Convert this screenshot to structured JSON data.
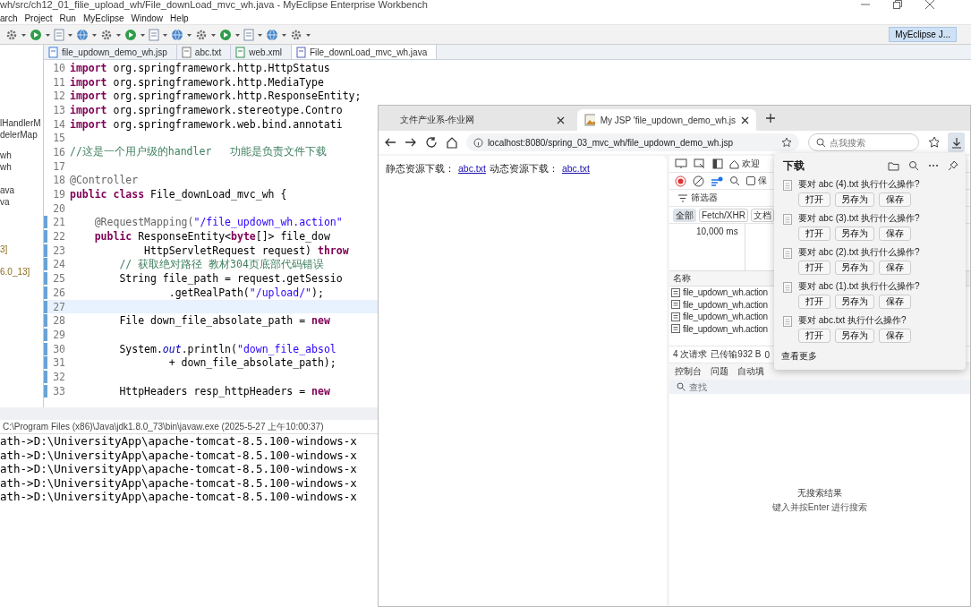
{
  "ide": {
    "title": "wh/src/ch12_01_filie_upload_wh/File_downLoad_mvc_wh.java - MyEclipse Enterprise Workbench",
    "menus": [
      "arch",
      "Project",
      "Run",
      "MyEclipse",
      "Window",
      "Help"
    ],
    "perspective": "MyEclipse J...",
    "editor_tabs": [
      {
        "label": "file_updown_demo_wh.jsp",
        "kind": "jsp",
        "selected": false
      },
      {
        "label": "abc.txt",
        "kind": "txt",
        "selected": false
      },
      {
        "label": "web.xml",
        "kind": "xml",
        "selected": false
      },
      {
        "label": "File_downLoad_mvc_wh.java",
        "kind": "java",
        "selected": true
      }
    ],
    "explorer": [
      "lHandlerM",
      "delerMap",
      "wh",
      "wh",
      "ava",
      "va",
      "3]",
      "6.0_13]"
    ],
    "code_lines": [
      {
        "number": "10",
        "current": false,
        "segments": [
          {
            "kind": "keyword",
            "text": "import"
          },
          {
            "kind": "plain",
            "text": " org.springframework.http.HttpStatus"
          }
        ]
      },
      {
        "number": "11",
        "current": false,
        "segments": [
          {
            "kind": "keyword",
            "text": "import"
          },
          {
            "kind": "plain",
            "text": " org.springframework.http.MediaType"
          }
        ]
      },
      {
        "number": "12",
        "current": false,
        "segments": [
          {
            "kind": "keyword",
            "text": "import"
          },
          {
            "kind": "plain",
            "text": " org.springframework.http.ResponseEntity;"
          }
        ]
      },
      {
        "number": "13",
        "current": false,
        "segments": [
          {
            "kind": "keyword",
            "text": "import"
          },
          {
            "kind": "plain",
            "text": " org.springframework.stereotype.Contro"
          }
        ]
      },
      {
        "number": "14",
        "current": false,
        "segments": [
          {
            "kind": "keyword",
            "text": "import"
          },
          {
            "kind": "plain",
            "text": " org.springframework.web.bind.annotati"
          }
        ]
      },
      {
        "number": "15",
        "current": false
      },
      {
        "number": "16",
        "current": false,
        "segments": [
          {
            "kind": "comment",
            "text": "//这是一个用户级的handler   功能是负责文件下载"
          }
        ]
      },
      {
        "number": "17",
        "current": false
      },
      {
        "number": "18",
        "current": false,
        "segments": [
          {
            "kind": "annotation",
            "text": "@Controller"
          }
        ]
      },
      {
        "number": "19",
        "current": false,
        "segments": [
          {
            "kind": "keyword",
            "text": "public class"
          },
          {
            "kind": "plain",
            "text": " File_downLoad_mvc_wh {"
          }
        ]
      },
      {
        "number": "20",
        "current": false
      },
      {
        "number": "21",
        "current": false,
        "segments": [
          {
            "kind": "annotation",
            "text": "    @RequestMapping("
          },
          {
            "kind": "string",
            "text": "\"/file_updown_wh.action\""
          }
        ]
      },
      {
        "number": "22",
        "current": false,
        "segments": [
          {
            "kind": "keyword",
            "text": "    public"
          },
          {
            "kind": "plain",
            "text": " ResponseEntity<"
          },
          {
            "kind": "keyword",
            "text": "byte"
          },
          {
            "kind": "plain",
            "text": "[]> file_dow"
          }
        ]
      },
      {
        "number": "23",
        "current": false,
        "segments": [
          {
            "kind": "plain",
            "text": "            HttpServletRequest request) "
          },
          {
            "kind": "keyword",
            "text": "throw"
          }
        ]
      },
      {
        "number": "24",
        "current": false,
        "segments": [
          {
            "kind": "comment",
            "text": "        // 获取绝对路径 教材304页底部代码错误"
          }
        ]
      },
      {
        "number": "25",
        "current": false,
        "segments": [
          {
            "kind": "plain",
            "text": "        String file_path = request.getSessio"
          }
        ]
      },
      {
        "number": "26",
        "current": false,
        "segments": [
          {
            "kind": "plain",
            "text": "                .getRealPath("
          },
          {
            "kind": "string",
            "text": "\"/upload/\""
          },
          {
            "kind": "plain",
            "text": ");"
          }
        ]
      },
      {
        "number": "27",
        "current": true
      },
      {
        "number": "28",
        "current": false,
        "segments": [
          {
            "kind": "plain",
            "text": "        File down_file_absolate_path = "
          },
          {
            "kind": "keyword",
            "text": "new"
          }
        ]
      },
      {
        "number": "29",
        "current": false
      },
      {
        "number": "30",
        "current": false,
        "segments": [
          {
            "kind": "plain",
            "text": "        System."
          },
          {
            "kind": "field",
            "text": "out"
          },
          {
            "kind": "plain",
            "text": ".println("
          },
          {
            "kind": "string",
            "text": "\"down_file_absol"
          }
        ]
      },
      {
        "number": "31",
        "current": false,
        "segments": [
          {
            "kind": "plain",
            "text": "                + down_file_absolate_path);"
          }
        ]
      },
      {
        "number": "32",
        "current": false
      },
      {
        "number": "33",
        "current": false,
        "segments": [
          {
            "kind": "plain",
            "text": "        HttpHeaders resp_httpHeaders = "
          },
          {
            "kind": "keyword",
            "text": "new"
          }
        ]
      }
    ],
    "console": {
      "header": "C:\\Program Files (x86)\\Java\\jdk1.8.0_73\\bin\\javaw.exe (2025-5-27 上午10:00:37)",
      "lines": [
        "ath->D:\\UniversityApp\\apache-tomcat-8.5.100-windows-x",
        "ath->D:\\UniversityApp\\apache-tomcat-8.5.100-windows-x",
        "ath->D:\\UniversityApp\\apache-tomcat-8.5.100-windows-x",
        "ath->D:\\UniversityApp\\apache-tomcat-8.5.100-windows-x",
        "ath->D:\\UniversityApp\\apache-tomcat-8.5.100-windows-x"
      ]
    }
  },
  "browser": {
    "tabs": [
      {
        "label": "文件产业系-作业网",
        "selected": false
      },
      {
        "label": "My JSP 'file_updown_demo_wh.js",
        "selected": true
      }
    ],
    "address": "localhost:8080/spring_03_mvc_wh/file_updown_demo_wh.jsp",
    "search": {
      "placeholder": "点我搜索"
    },
    "page": [
      {
        "kind": "text",
        "text": "静态资源下载："
      },
      {
        "kind": "link",
        "text": "abc.txt"
      },
      {
        "kind": "text",
        "text": "动态资源下载："
      },
      {
        "kind": "link",
        "text": "abc.txt"
      }
    ],
    "devtools": {
      "welcome_tab": "欢迎",
      "preserve_log": {
        "label": "保",
        "checked": false
      },
      "filter": "筛选器",
      "chips": [
        {
          "label": "全部",
          "selected": true
        },
        {
          "label": "Fetch/XHR",
          "selected": false
        },
        {
          "label": "文档",
          "selected": false
        }
      ],
      "timeline_label": "10,000 ms",
      "name_header": "名称",
      "requests": [
        "file_updown_wh.action",
        "file_updown_wh.action",
        "file_updown_wh.action",
        "file_updown_wh.action"
      ],
      "summary": [
        "4 次请求",
        "已传输932 B",
        "0"
      ],
      "drawer_tabs": [
        "控制台",
        "问题",
        "自动填"
      ],
      "find": {
        "placeholder": "查找"
      },
      "empty": {
        "title": "无搜索结果",
        "hint": "键入并按Enter 进行搜索"
      }
    },
    "downloads": {
      "title": "下载",
      "items": [
        {
          "question": "要对 abc (4).txt 执行什么操作?",
          "actions": [
            "打开",
            "另存为",
            "保存"
          ]
        },
        {
          "question": "要对 abc (3).txt 执行什么操作?",
          "actions": [
            "打开",
            "另存为",
            "保存"
          ]
        },
        {
          "question": "要对 abc (2).txt 执行什么操作?",
          "actions": [
            "打开",
            "另存为",
            "保存"
          ]
        },
        {
          "question": "要对 abc (1).txt 执行什么操作?",
          "actions": [
            "打开",
            "另存为",
            "保存"
          ]
        },
        {
          "question": "要对 abc.txt 执行什么操作?",
          "actions": [
            "打开",
            "另存为",
            "保存"
          ]
        }
      ],
      "more": "查看更多"
    }
  }
}
